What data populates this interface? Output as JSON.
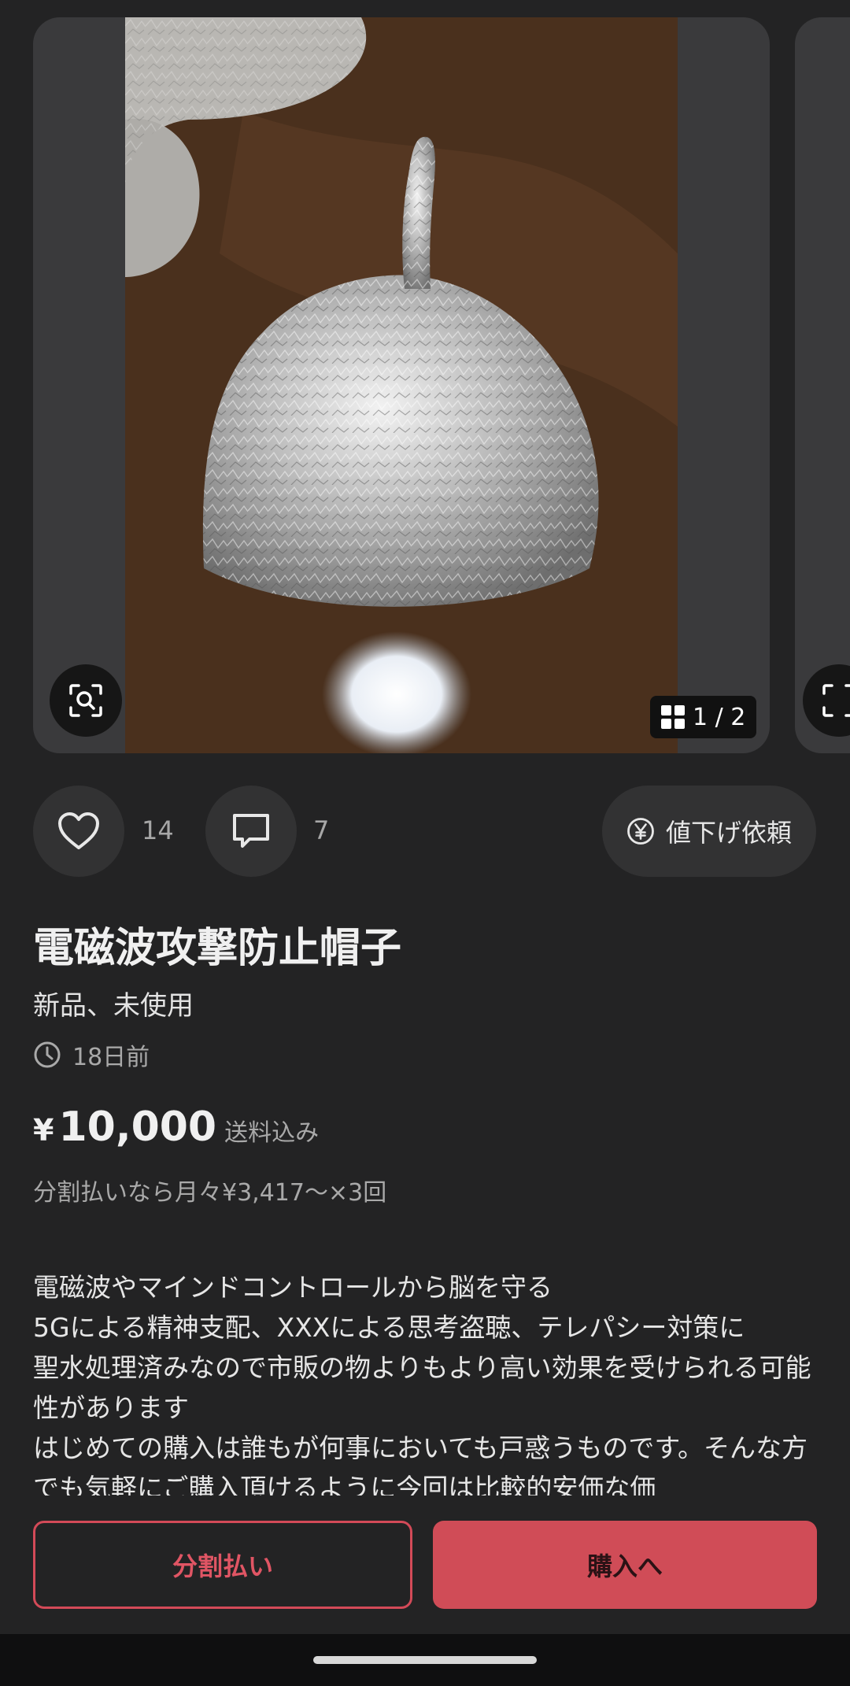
{
  "gallery": {
    "counter": "1 / 2"
  },
  "actions": {
    "likes_count": "14",
    "comments_count": "7",
    "price_cut_label": "値下げ依頼",
    "price_cut_icon": "yen-circle-icon"
  },
  "item": {
    "title": "電磁波攻撃防止帽子",
    "condition": "新品、未使用",
    "posted": "18日前",
    "price_currency": "¥",
    "price": "10,000",
    "shipping_note": "送料込み",
    "installment_note": "分割払いなら月々¥3,417〜×3回",
    "description": "電磁波やマインドコントロールから脳を守る\n5Gによる精神支配、XXXによる思考盗聴、テレパシー対策に\n聖水処理済みなので市販の物よりもより高い効果を受けられる可能性があります\nはじめての購入は誰もが何事においても戸惑うものです。そんな方でも気軽にご購入頂けるように今回は比較的安価な価"
  },
  "bottom_bar": {
    "installment_button": "分割払い",
    "buy_button": "購入へ"
  },
  "colors": {
    "accent": "#d04c57",
    "background": "#232324"
  }
}
